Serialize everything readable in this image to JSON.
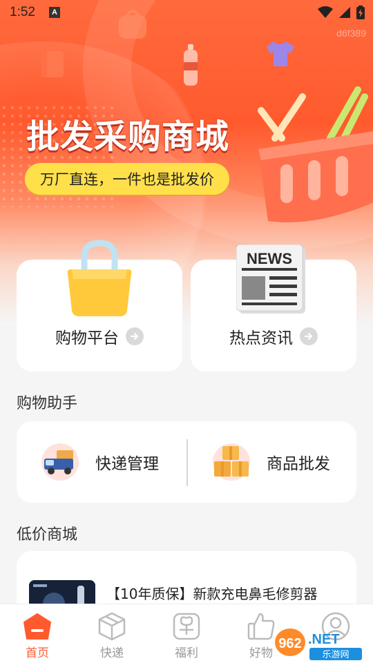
{
  "status_bar": {
    "time": "1:52",
    "notification_badge": "A"
  },
  "watermark": "d6f389",
  "hero": {
    "title": "批发采购商城",
    "subtitle": "万厂直连，一件也是批发价"
  },
  "feature_cards": [
    {
      "label": "购物平台",
      "icon": "shopping-bag-icon"
    },
    {
      "label": "热点资讯",
      "icon": "newspaper-icon",
      "icon_text": "NEWS"
    }
  ],
  "assistant": {
    "title": "购物助手",
    "items": [
      {
        "label": "快递管理",
        "icon": "delivery-truck-icon"
      },
      {
        "label": "商品批发",
        "icon": "boxes-icon"
      }
    ]
  },
  "mall": {
    "title": "低价商城",
    "products": [
      {
        "name": "【10年质保】新款充电鼻毛修剪器"
      }
    ]
  },
  "tabbar": {
    "tabs": [
      {
        "label": "首页",
        "icon": "home-icon",
        "active": true
      },
      {
        "label": "快递",
        "icon": "package-icon",
        "active": false
      },
      {
        "label": "福利",
        "icon": "gift-icon",
        "active": false
      },
      {
        "label": "好物",
        "icon": "thumbs-up-icon",
        "active": false
      },
      {
        "label": "",
        "icon": "user-icon",
        "active": false
      }
    ]
  },
  "site_logo": {
    "number": "962",
    "suffix": ".NET",
    "caption": "乐游网"
  },
  "colors": {
    "accent": "#ff5a2e",
    "pill": "#ffe04a",
    "background": "#f5f5f5"
  }
}
